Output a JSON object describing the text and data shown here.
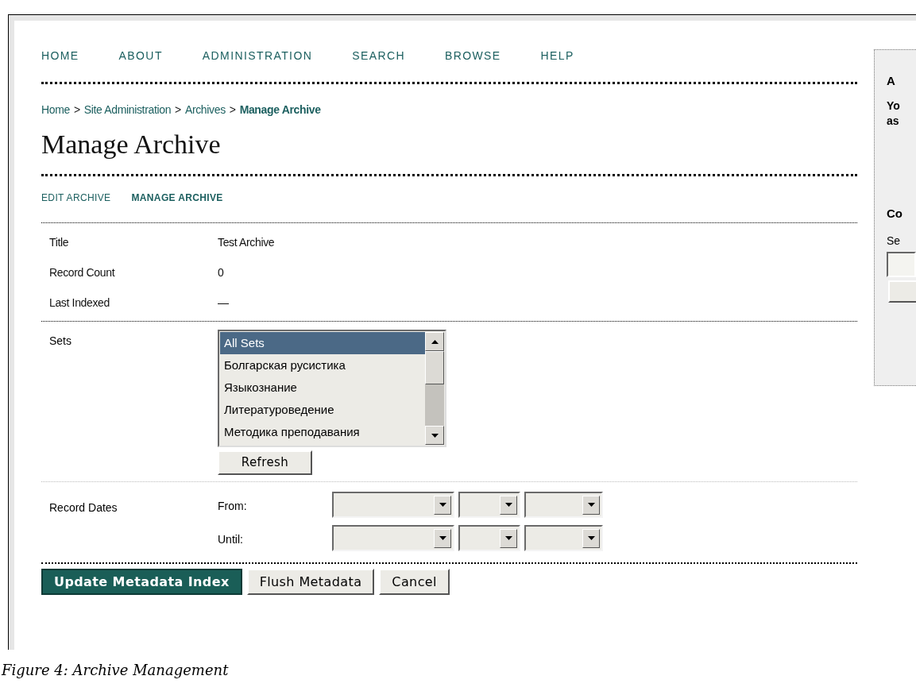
{
  "nav": [
    {
      "label": "HOME"
    },
    {
      "label": "ABOUT"
    },
    {
      "label": "ADMINISTRATION"
    },
    {
      "label": "SEARCH"
    },
    {
      "label": "BROWSE"
    },
    {
      "label": "HELP"
    }
  ],
  "breadcrumb": [
    {
      "label": "Home",
      "current": false
    },
    {
      "label": "Site Administration",
      "current": false
    },
    {
      "label": "Archives",
      "current": false
    },
    {
      "label": "Manage Archive",
      "current": true
    }
  ],
  "breadcrumb_separator": ">",
  "page_title": "Manage Archive",
  "subnav": [
    {
      "label": "EDIT ARCHIVE",
      "selected": false
    },
    {
      "label": "MANAGE ARCHIVE",
      "selected": true
    }
  ],
  "info_rows": [
    {
      "label": "Title",
      "value": "Test Archive"
    },
    {
      "label": "Record Count",
      "value": "0"
    },
    {
      "label": "Last Indexed",
      "value": "—"
    }
  ],
  "sets": {
    "label": "Sets",
    "options": [
      {
        "label": "All Sets",
        "selected": true
      },
      {
        "label": "Болгарская русистика",
        "selected": false
      },
      {
        "label": "Языкознание",
        "selected": false
      },
      {
        "label": "Литературоведение",
        "selected": false
      },
      {
        "label": "Методика преподавания",
        "selected": false
      }
    ],
    "refresh_button": "Refresh"
  },
  "record_dates": {
    "label": "Record Dates",
    "rows": [
      {
        "label": "From:"
      },
      {
        "label": "Until:"
      }
    ]
  },
  "buttons": [
    {
      "label": "Update Metadata Index",
      "primary": true
    },
    {
      "label": "Flush Metadata",
      "primary": false
    },
    {
      "label": "Cancel",
      "primary": false
    }
  ],
  "sidebar": {
    "heading": "A",
    "text_lines": [
      "Yo",
      "as"
    ],
    "section_heading": "Co",
    "section_label": "Se"
  },
  "caption": "Figure 4: Archive Management"
}
